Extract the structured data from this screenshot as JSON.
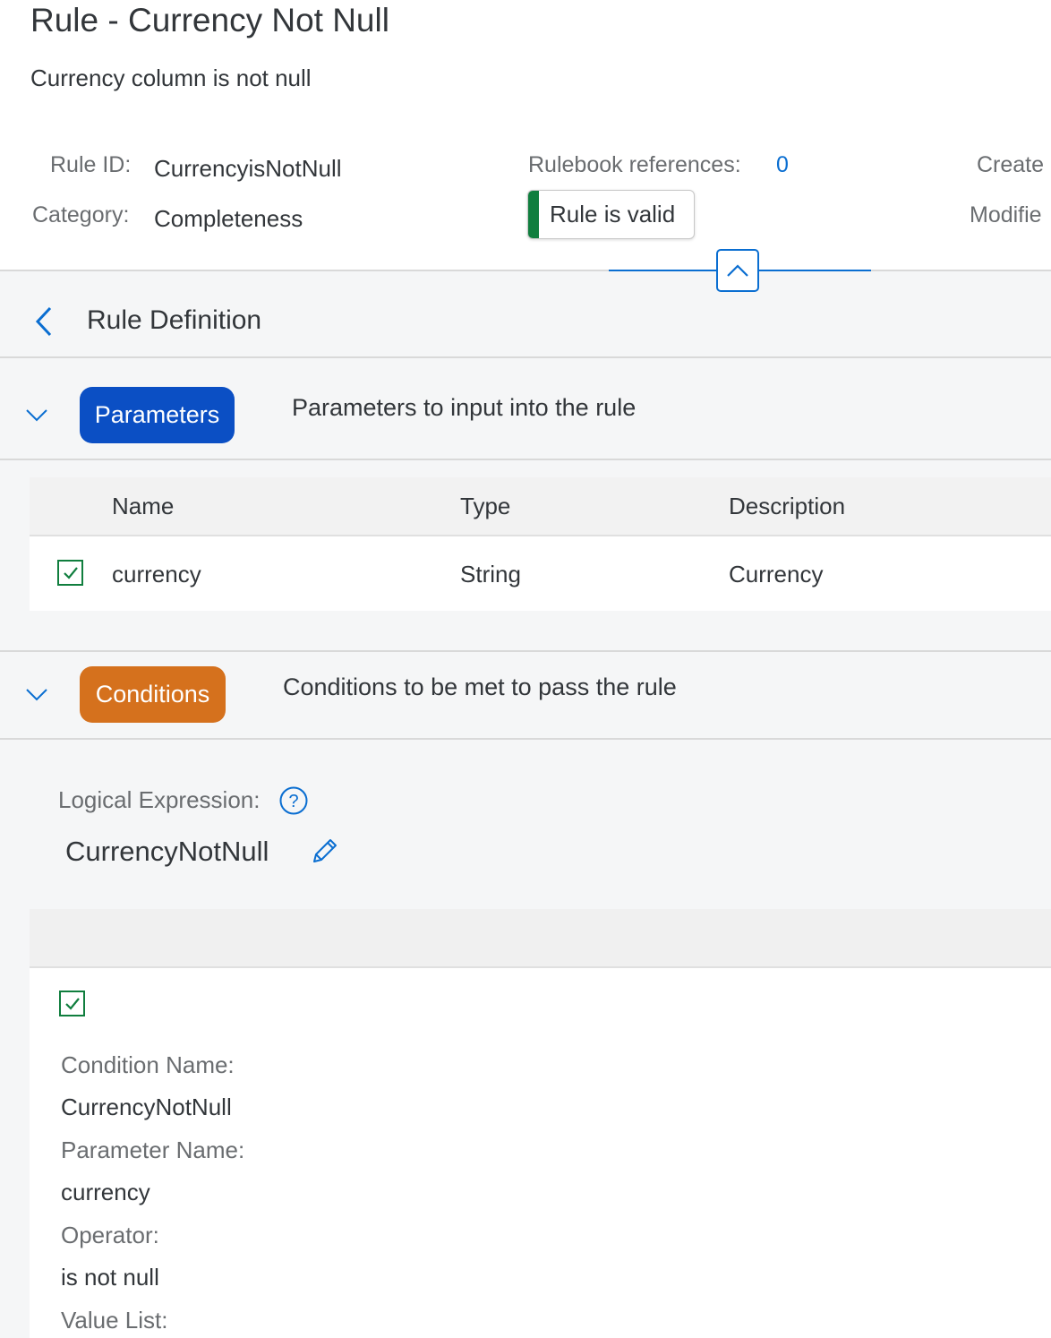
{
  "header": {
    "title": "Rule - Currency Not Null",
    "subtitle": "Currency column is not null",
    "rule_id_label": "Rule ID:",
    "rule_id_value": "CurrencyisNotNull",
    "category_label": "Category:",
    "category_value": "Completeness",
    "rulebook_refs_label": "Rulebook references:",
    "rulebook_refs_value": "0",
    "status_text": "Rule is valid",
    "created_label_partial": "Create",
    "modified_label_partial": "Modifie"
  },
  "rule_definition": {
    "title": "Rule Definition"
  },
  "parameters": {
    "pill_label": "Parameters",
    "description": "Parameters to input into the rule",
    "columns": [
      "Name",
      "Type",
      "Description"
    ],
    "rows": [
      {
        "checked": true,
        "name": "currency",
        "type": "String",
        "description": "Currency"
      }
    ]
  },
  "conditions": {
    "pill_label": "Conditions",
    "description": "Conditions to be met to pass the rule",
    "logical_expression_label": "Logical Expression:",
    "logical_expression_value": "CurrencyNotNull",
    "condition": {
      "checked": true,
      "condition_name_label": "Condition Name:",
      "condition_name_value": "CurrencyNotNull",
      "parameter_name_label": "Parameter Name:",
      "parameter_name_value": "currency",
      "operator_label": "Operator:",
      "operator_value": "is not null",
      "value_list_label": "Value List:"
    }
  },
  "colors": {
    "accent": "#0a6ed1",
    "parameters_pill": "#0b4fc4",
    "conditions_pill": "#d5711d",
    "valid_green": "#107e3e"
  },
  "icons": {
    "collapse": "chevron-up-icon",
    "back": "chevron-left-icon",
    "section_toggle": "chevron-down-icon",
    "help": "question-circle-icon",
    "edit": "pencil-icon",
    "check": "checkmark-icon"
  }
}
